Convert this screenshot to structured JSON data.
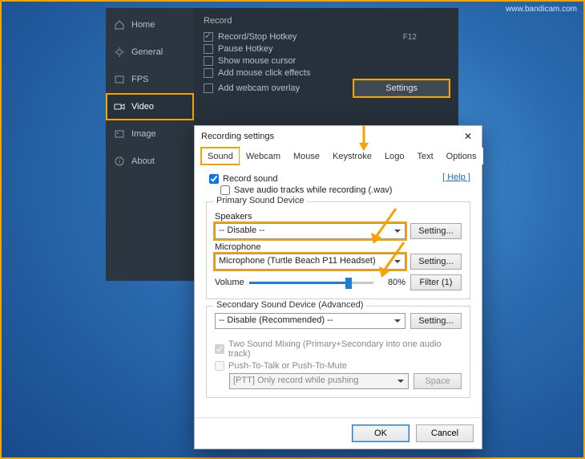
{
  "watermark": "www.bandicam.com",
  "sidebar": {
    "items": [
      {
        "label": "Home"
      },
      {
        "label": "General"
      },
      {
        "label": "FPS"
      },
      {
        "label": "Video"
      },
      {
        "label": "Image"
      },
      {
        "label": "About"
      }
    ]
  },
  "panel": {
    "header": "Record",
    "record_hotkey_label": "Record/Stop Hotkey",
    "record_hotkey_value": "F12",
    "pause_hotkey_label": "Pause Hotkey",
    "show_mouse_label": "Show mouse cursor",
    "add_click_label": "Add mouse click effects",
    "add_webcam_label": "Add webcam overlay",
    "settings_btn": "Settings"
  },
  "dialog": {
    "title": "Recording settings",
    "tabs": [
      "Sound",
      "Webcam",
      "Mouse",
      "Keystroke",
      "Logo",
      "Text",
      "Options"
    ],
    "record_sound": "Record sound",
    "save_tracks": "Save audio tracks while recording (.wav)",
    "help": "[ Help ]",
    "primary_group": "Primary Sound Device",
    "speakers_label": "Speakers",
    "speakers_value": "-- Disable --",
    "mic_label": "Microphone",
    "mic_value": "Microphone (Turtle Beach P11 Headset)",
    "setting_btn": "Setting...",
    "volume_label": "Volume",
    "volume_pct": "80%",
    "filter_btn": "Filter (1)",
    "secondary_group": "Secondary Sound Device (Advanced)",
    "secondary_value": "-- Disable (Recommended) --",
    "two_mix": "Two Sound Mixing (Primary+Secondary into one audio track)",
    "ptt": "Push-To-Talk or Push-To-Mute",
    "ptt_mode": "[PTT] Only record while pushing",
    "ptt_key": "Space",
    "ok": "OK",
    "cancel": "Cancel"
  },
  "chart_data": null
}
